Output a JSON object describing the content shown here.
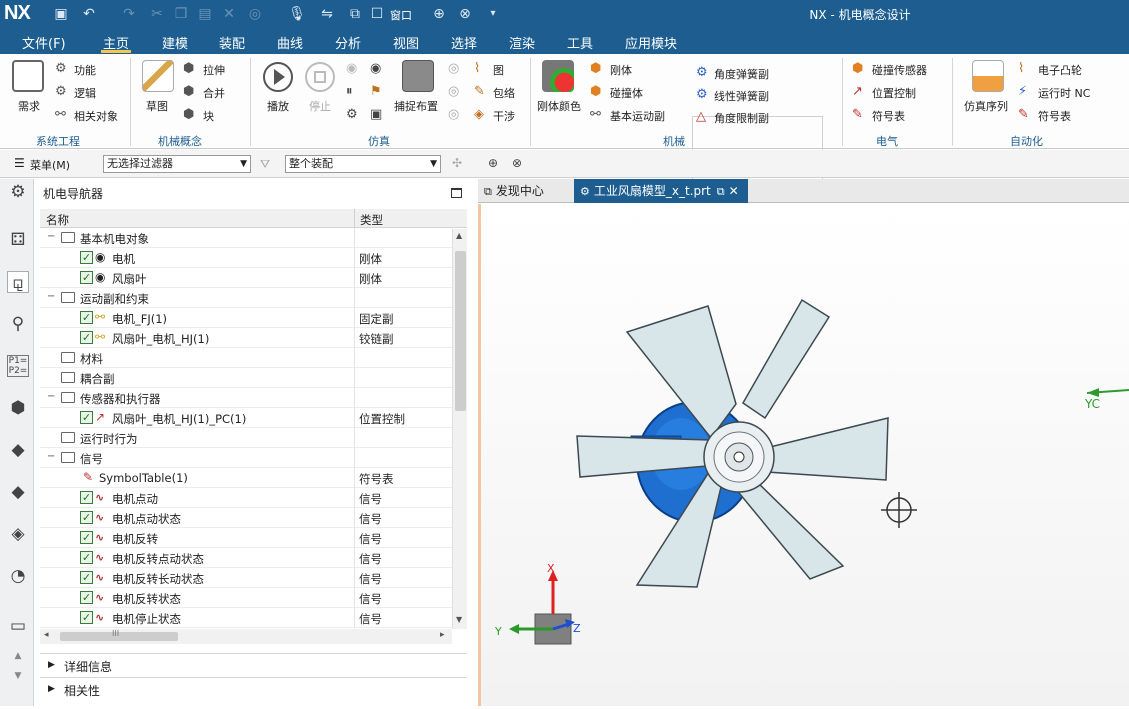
{
  "app": {
    "logo": "NX",
    "window_title": "NX - 机电概念设计"
  },
  "menubar": {
    "items": [
      "文件(F)",
      "主页",
      "建模",
      "装配",
      "曲线",
      "分析",
      "视图",
      "选择",
      "渲染",
      "工具",
      "应用模块"
    ],
    "active": "主页"
  },
  "ribbon": {
    "systems": {
      "big": "需求",
      "items": [
        "功能",
        "逻辑",
        "相关对象"
      ],
      "caption": "系统工程"
    },
    "mech_concept": {
      "big": "草图",
      "items": [
        "拉伸",
        "合并",
        "块"
      ],
      "caption": "机械概念"
    },
    "simulation": {
      "play": "播放",
      "stop": "停止",
      "capture": "捕捉布置",
      "items": [
        "图",
        "包络",
        "干涉"
      ],
      "caption": "仿真"
    },
    "mechanical": {
      "big": "刚体颜色",
      "items": [
        "刚体",
        "碰撞体",
        "基本运动副"
      ],
      "springs": [
        "角度弹簧副",
        "线性弹簧副",
        "角度限制副"
      ],
      "caption": "机械"
    },
    "electrical": {
      "items": [
        "碰撞传感器",
        "位置控制",
        "符号表"
      ],
      "caption": "电气"
    },
    "automation": {
      "big": "仿真序列",
      "items": [
        "电子凸轮",
        "运行时 NC",
        "符号表"
      ],
      "caption": "自动化"
    },
    "quick_window": "窗口"
  },
  "filterbar": {
    "menu": "菜单(M)",
    "filter": "无选择过滤器",
    "scope": "整个装配"
  },
  "navigator": {
    "title": "机电导航器",
    "columns": {
      "name": "名称",
      "type": "类型"
    },
    "rows": [
      {
        "kind": "folder",
        "indent": 0,
        "name": "基本机电对象",
        "type": ""
      },
      {
        "kind": "body",
        "indent": 1,
        "name": "电机",
        "type": "刚体"
      },
      {
        "kind": "body",
        "indent": 1,
        "name": "风扇叶",
        "type": "刚体"
      },
      {
        "kind": "folder",
        "indent": 0,
        "name": "运动副和约束",
        "type": ""
      },
      {
        "kind": "joint",
        "indent": 1,
        "name": "电机_FJ(1)",
        "type": "固定副"
      },
      {
        "kind": "joint",
        "indent": 1,
        "name": "风扇叶_电机_HJ(1)",
        "type": "铰链副"
      },
      {
        "kind": "folder-leaf",
        "indent": 0,
        "name": "材料",
        "type": ""
      },
      {
        "kind": "folder-leaf",
        "indent": 0,
        "name": "耦合副",
        "type": ""
      },
      {
        "kind": "folder",
        "indent": 0,
        "name": "传感器和执行器",
        "type": ""
      },
      {
        "kind": "actuator",
        "indent": 1,
        "name": "风扇叶_电机_HJ(1)_PC(1)",
        "type": "位置控制"
      },
      {
        "kind": "folder-leaf",
        "indent": 0,
        "name": "运行时行为",
        "type": ""
      },
      {
        "kind": "folder",
        "indent": 0,
        "name": "信号",
        "type": ""
      },
      {
        "kind": "table",
        "indent": 1,
        "name": "SymbolTable(1)",
        "type": "符号表"
      },
      {
        "kind": "signal",
        "indent": 1,
        "name": "电机点动",
        "type": "信号"
      },
      {
        "kind": "signal",
        "indent": 1,
        "name": "电机点动状态",
        "type": "信号"
      },
      {
        "kind": "signal",
        "indent": 1,
        "name": "电机反转",
        "type": "信号"
      },
      {
        "kind": "signal",
        "indent": 1,
        "name": "电机反转点动状态",
        "type": "信号"
      },
      {
        "kind": "signal",
        "indent": 1,
        "name": "电机反转长动状态",
        "type": "信号"
      },
      {
        "kind": "signal",
        "indent": 1,
        "name": "电机反转状态",
        "type": "信号"
      },
      {
        "kind": "signal",
        "indent": 1,
        "name": "电机停止状态",
        "type": "信号"
      }
    ],
    "hscroll_label": "III",
    "panels": [
      "详细信息",
      "相关性"
    ]
  },
  "graphics": {
    "tabs": [
      "发现中心",
      "工业风扇模型_x_t.prt"
    ],
    "triad": {
      "x": "X",
      "y": "Y",
      "z": "Z"
    },
    "wcs_label": "YC"
  },
  "colors": {
    "titlebar": "#1d5d90",
    "accent": "#f2c94c",
    "blade": "#d8e6ea",
    "motor": "#1f6fd1"
  }
}
